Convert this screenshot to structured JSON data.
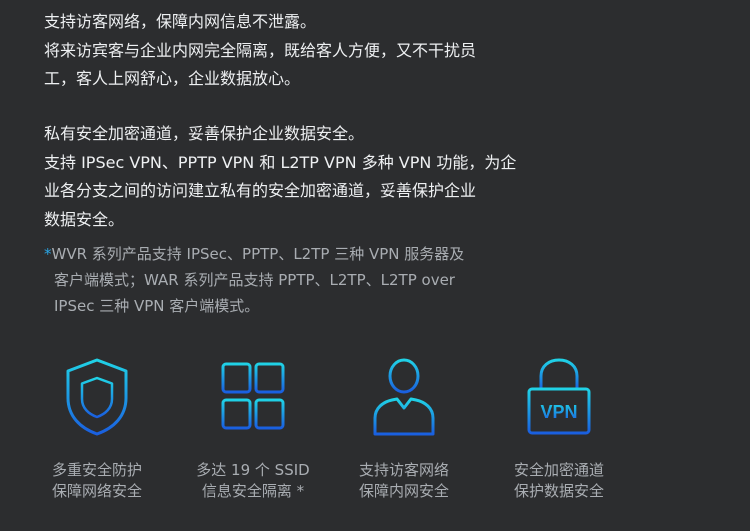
{
  "paragraph_guest": {
    "lines": [
      "支持访客网络，保障内网信息不泄露。",
      "将来访宾客与企业内网完全隔离，既给客人方便，又不干扰员",
      "工，客人上网舒心，企业数据放心。"
    ]
  },
  "paragraph_vpn": {
    "lines": [
      "私有安全加密通道，妥善保护企业数据安全。",
      "支持 IPSec VPN、PPTP VPN 和 L2TP VPN 多种 VPN 功能，为企",
      "业各分支之间的访问建立私有的安全加密通道，妥善保护企业",
      "数据安全。"
    ]
  },
  "footnote": {
    "marker": "*",
    "lines": [
      "WVR 系列产品支持 IPSec、PPTP、L2TP 三种 VPN 服务器及",
      "客户端模式；WAR 系列产品支持 PPTP、L2TP、L2TP over",
      "IPSec 三种 VPN 客户端模式。"
    ]
  },
  "features": [
    {
      "icon": "shield-icon",
      "line1": "多重安全防护",
      "line2": "保障网络安全"
    },
    {
      "icon": "grid-icon",
      "line1": "多达 19 个 SSID",
      "line2": "信息安全隔离 *"
    },
    {
      "icon": "user-icon",
      "line1": "支持访客网络",
      "line2": "保障内网安全"
    },
    {
      "icon": "vpn-lock-icon",
      "line1": "安全加密通道",
      "line2": "保护数据安全",
      "badge": "VPN"
    }
  ],
  "colors": {
    "background": "#2c2d2f",
    "text": "#eef0f2",
    "muted_text": "#a9adb2",
    "icon_gradient_top": "#20d2e6",
    "icon_gradient_bottom": "#1a5fe0"
  }
}
